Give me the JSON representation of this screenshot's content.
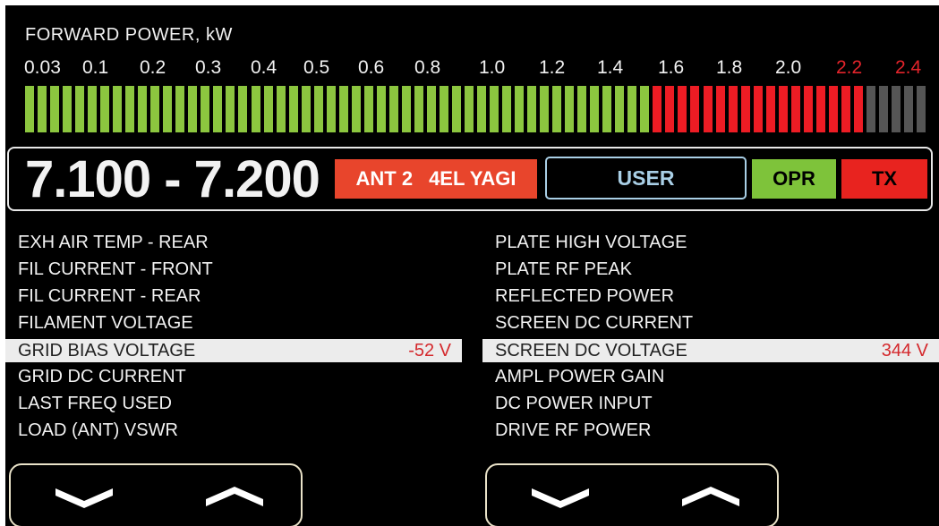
{
  "forward_power": {
    "title": "FORWARD POWER, kW",
    "scale_labels": [
      "0.03",
      "0.1",
      "0.2",
      "0.3",
      "0.4",
      "0.5",
      "0.6",
      "0.8",
      "1.0",
      "1.2",
      "1.4",
      "1.6",
      "1.8",
      "2.0",
      "2.2",
      "2.4"
    ],
    "scale_alert_labels": [
      "2.2",
      "2.4"
    ],
    "bar_segments": {
      "green": 50,
      "red": 17,
      "grey": 5
    },
    "colors": {
      "green": "#8cc63f",
      "red": "#ed1c24",
      "grey": "#555555",
      "alert_text": "#e3242b"
    }
  },
  "band": {
    "frequency_range": "7.100 - 7.200",
    "antenna_port": "ANT 2",
    "antenna_name": "4EL YAGI",
    "mode": "USER",
    "operate": "OPR",
    "transmit": "TX",
    "colors": {
      "antenna_bg": "#e8452c",
      "user_border": "#a9cfe6",
      "opr_bg": "#7ec33a",
      "tx_bg": "#e8231f"
    }
  },
  "parameters_left": [
    {
      "label": "EXH  AIR  TEMP - REAR",
      "value": ""
    },
    {
      "label": "FIL  CURRENT -  FRONT",
      "value": ""
    },
    {
      "label": "FIL  CURRENT - REAR",
      "value": ""
    },
    {
      "label": "FILAMENT  VOLTAGE",
      "value": ""
    },
    {
      "label": "GRID  BIAS  VOLTAGE",
      "value": "-52 V",
      "selected": true
    },
    {
      "label": "GRID  DC  CURRENT",
      "value": ""
    },
    {
      "label": "LAST  FREQ  USED",
      "value": ""
    },
    {
      "label": "LOAD  (ANT)  VSWR",
      "value": ""
    }
  ],
  "parameters_right": [
    {
      "label": "PLATE  HIGH  VOLTAGE",
      "value": ""
    },
    {
      "label": "PLATE  RF  PEAK",
      "value": ""
    },
    {
      "label": "REFLECTED  POWER",
      "value": ""
    },
    {
      "label": "SCREEN  DC  CURRENT",
      "value": ""
    },
    {
      "label": "SCREEN  DC  VOLTAGE",
      "value": "344 V",
      "selected": true
    },
    {
      "label": "AMPL  POWER  GAIN",
      "value": ""
    },
    {
      "label": "DC  POWER  INPUT",
      "value": ""
    },
    {
      "label": "DRIVE  RF  POWER",
      "value": ""
    }
  ],
  "navigation": {
    "left": {
      "down_icon": "chevron-down-icon",
      "up_icon": "chevron-up-icon"
    },
    "right": {
      "down_icon": "chevron-down-icon",
      "up_icon": "chevron-up-icon"
    }
  }
}
